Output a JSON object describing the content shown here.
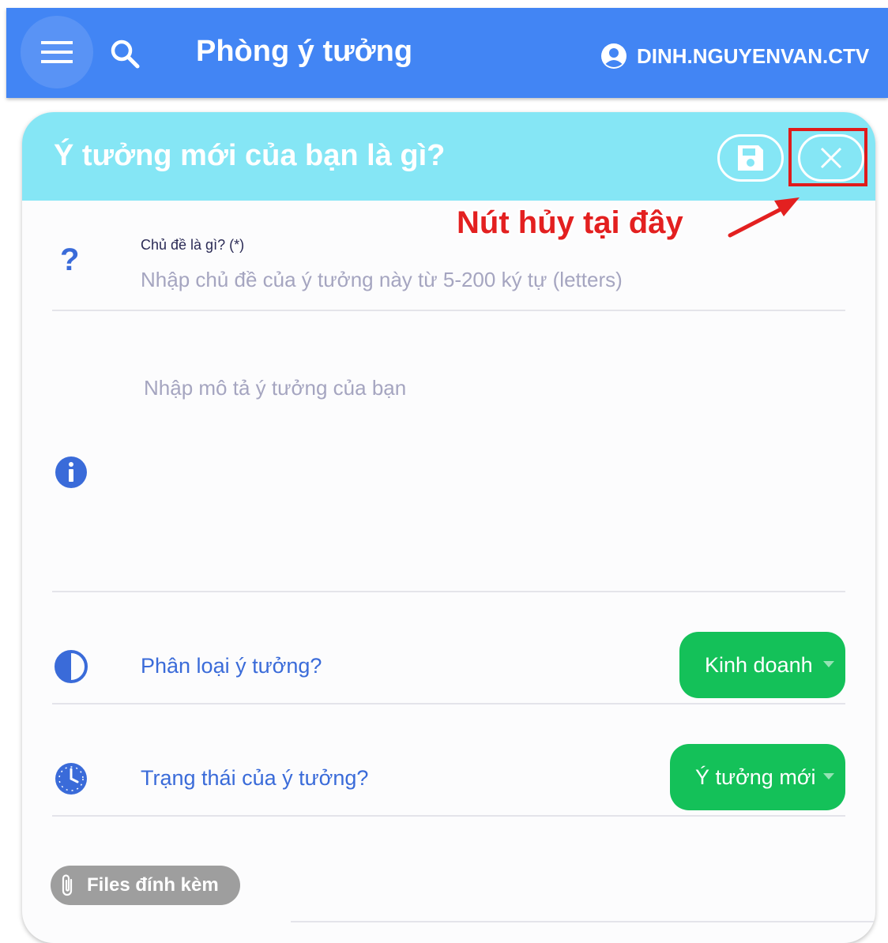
{
  "appbar": {
    "title": "Phòng ý tưởng",
    "user": "DINH.NGUYENVAN.CTV",
    "color": "#4285f4",
    "icons": {
      "menu": "menu-icon",
      "search": "search-icon",
      "account": "account-circle-icon"
    }
  },
  "card": {
    "title": "Ý tưởng mới của bạn là gì?",
    "header_color": "#85e6f5",
    "save_icon": "floppy-disk-icon",
    "close_icon": "close-icon"
  },
  "annotation": {
    "text": "Nút hủy tại đây",
    "color": "#e32020"
  },
  "form": {
    "subject": {
      "icon": "question-mark-icon",
      "label": "Chủ đề là gì? (*)",
      "placeholder": "Nhập chủ đề của ý tưởng này từ 5-200 ký tự (letters)",
      "value": ""
    },
    "description": {
      "icon": "info-icon",
      "placeholder": "Nhập mô tả ý tưởng của bạn",
      "value": ""
    },
    "category": {
      "icon": "half-circle-icon",
      "label": "Phân loại ý tưởng?",
      "selected": "Kinh doanh"
    },
    "status": {
      "icon": "clock-icon",
      "label": "Trạng thái của ý tưởng?",
      "selected": "Ý tưởng mới"
    },
    "attachments": {
      "icon": "paperclip-icon",
      "label": "Files đính kèm"
    }
  },
  "colors": {
    "pill": "#14c159",
    "label_blue": "#3a6bd9",
    "chip": "#9e9e9e"
  }
}
